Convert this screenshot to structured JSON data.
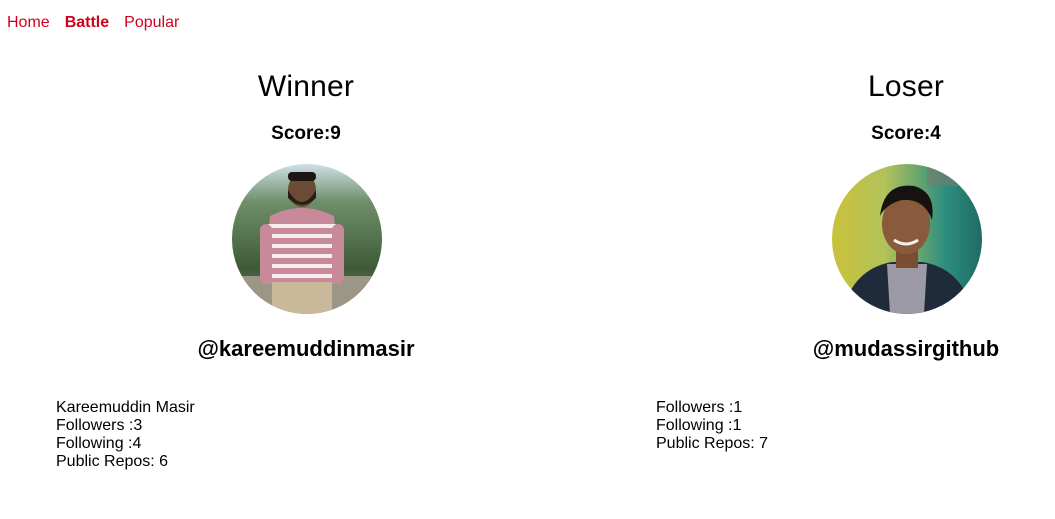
{
  "nav": {
    "items": [
      {
        "label": "Home",
        "active": false
      },
      {
        "label": "Battle",
        "active": true
      },
      {
        "label": "Popular",
        "active": false
      }
    ],
    "link_color": "#d0021b"
  },
  "players": [
    {
      "result": "Winner",
      "score": "Score:9",
      "username": "@kareemuddinmasir",
      "avatar_icon": "avatar-photo",
      "details": [
        "Kareemuddin Masir",
        "Followers :3",
        "Following :4",
        "Public Repos: 6"
      ]
    },
    {
      "result": "Loser",
      "score": "Score:4",
      "username": "@mudassirgithub",
      "avatar_icon": "avatar-photo",
      "details": [
        "Followers :1",
        "Following :1",
        "Public Repos: 7"
      ]
    }
  ]
}
